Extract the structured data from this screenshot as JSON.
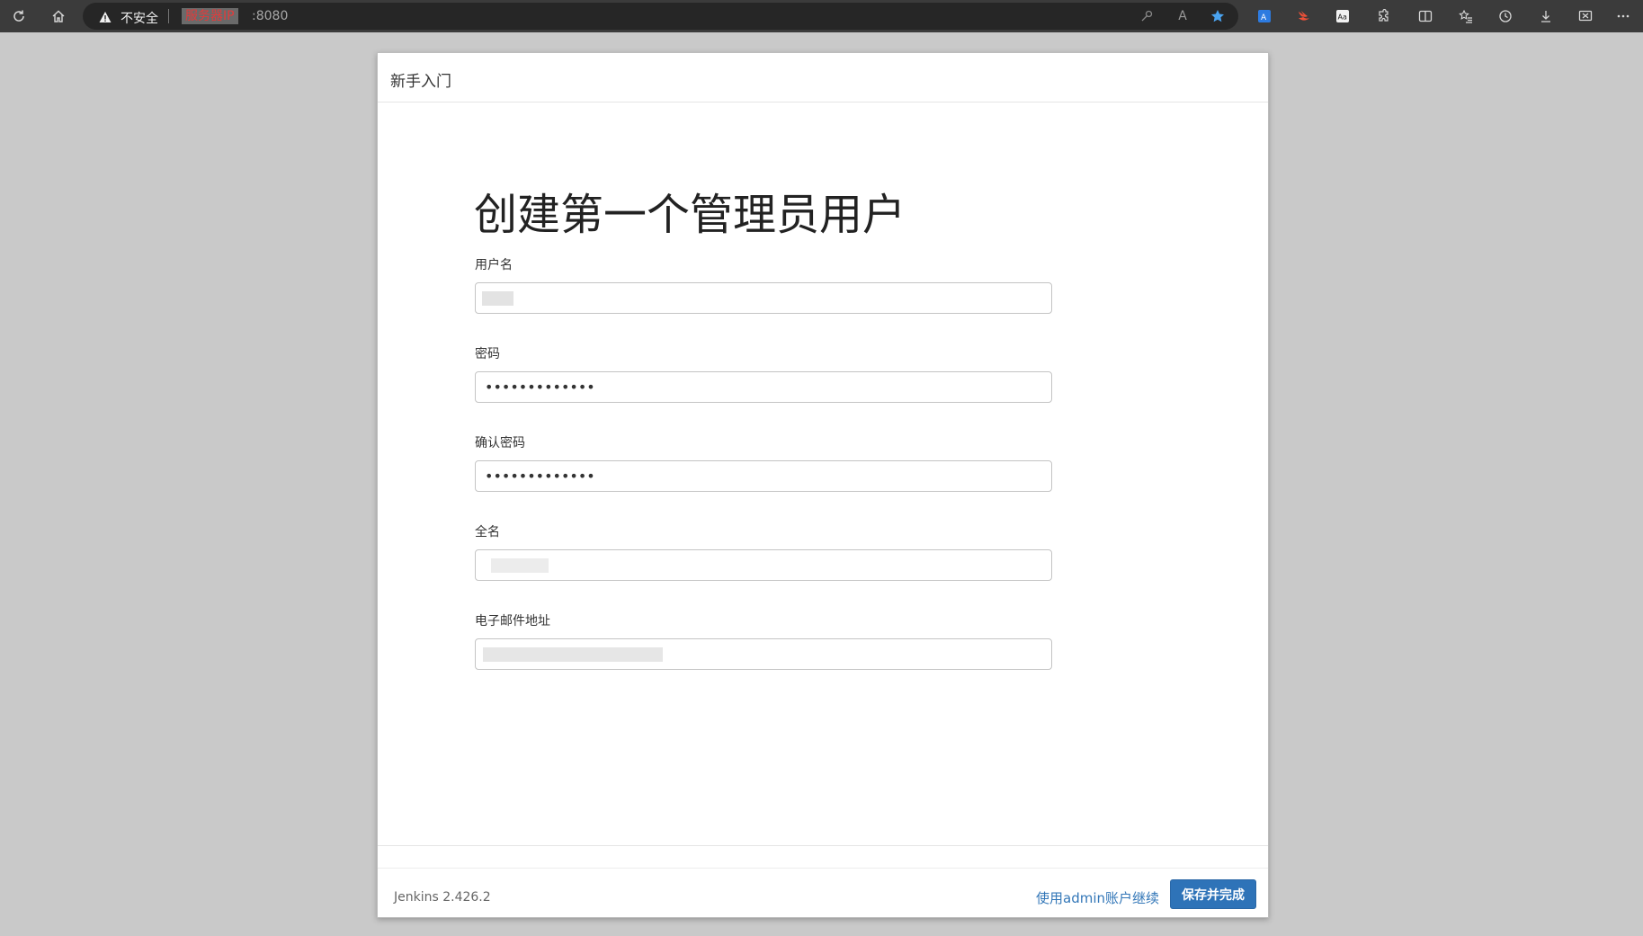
{
  "browser": {
    "insecure_label": "不安全",
    "address_masked": "服务器IP",
    "address_port": ":8080"
  },
  "dialog": {
    "header_title": "新手入门",
    "page_title": "创建第一个管理员用户",
    "fields": {
      "username": {
        "label": "用户名",
        "value": ""
      },
      "password": {
        "label": "密码",
        "value": "•••••••••••••"
      },
      "confirm_password": {
        "label": "确认密码",
        "value": "•••••••••••••"
      },
      "fullname": {
        "label": "全名",
        "value": ""
      },
      "email": {
        "label": "电子邮件地址",
        "value": ""
      }
    },
    "footer": {
      "version": "Jenkins 2.426.2",
      "continue_admin_link": "使用admin账户继续",
      "save_button": "保存并完成"
    }
  },
  "colors": {
    "primary_button": "#2e73b8",
    "link": "#3377b8",
    "address_masked_text": "#e23b3b"
  }
}
